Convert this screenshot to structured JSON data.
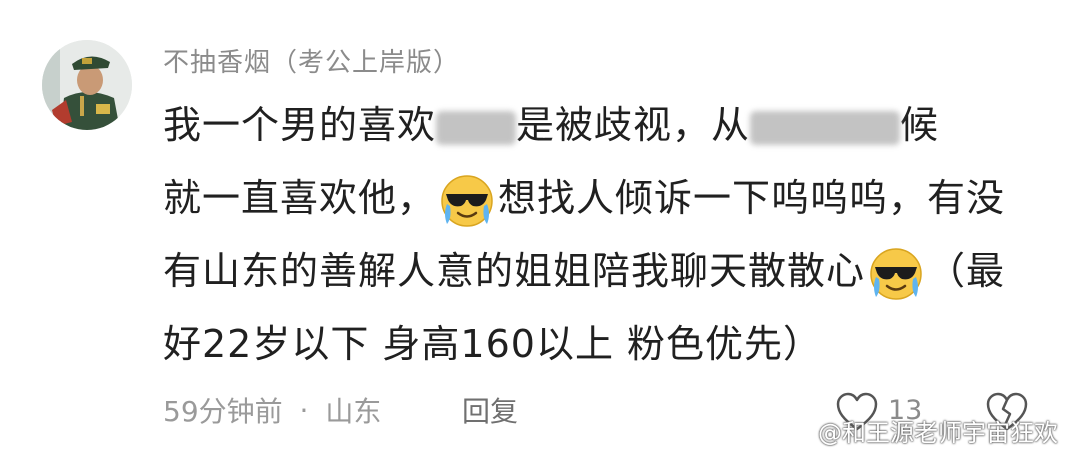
{
  "comment": {
    "username": "不抽香烟（考公上岸版）",
    "lines": {
      "l1_a": "我一个男的喜欢",
      "l1_b": "是被歧视，从",
      "l1_c": "候",
      "l2_a": "就一直喜欢他，",
      "l2_b": "想找人倾诉一下呜呜呜，有没",
      "l3_a": "有山东的善解人意的姐姐陪我聊天散散心",
      "l3_b": "（最",
      "l4": "好22岁以下  身高160以上 粉色优先）"
    },
    "emoji_icon": "sunglasses-crying-emoji",
    "meta": {
      "time": "59分钟前",
      "separator": "·",
      "location": "山东"
    },
    "reply_label": "回复",
    "like_count": "13"
  },
  "watermark": {
    "text": "@和王源老师宇宙狂欢",
    "icon": "weibo-icon"
  },
  "colors": {
    "text": "#202020",
    "secondary": "#8b8b8b",
    "background": "#ffffff",
    "emoji_face": "#f7c948"
  }
}
